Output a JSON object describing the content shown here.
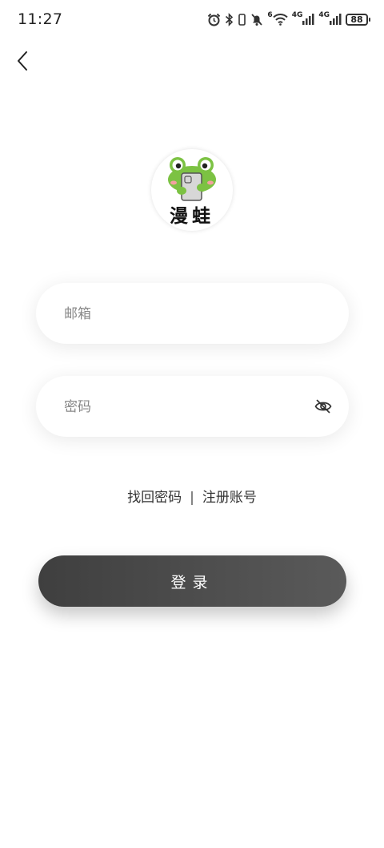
{
  "status_bar": {
    "time": "11:27",
    "network_1": "4G",
    "network_2": "4G",
    "wifi_badge": "6",
    "battery": "88"
  },
  "icons": {
    "back": "back-arrow-icon",
    "alarm": "alarm-icon",
    "bluetooth": "bluetooth-icon",
    "vibrate": "vibrate-icon",
    "mute": "bell-mute-icon",
    "wifi": "wifi-icon",
    "signal": "signal-icon",
    "eye": "eye-off-icon"
  },
  "logo": {
    "text": "漫蛙"
  },
  "form": {
    "email_placeholder": "邮箱",
    "email_value": "",
    "password_placeholder": "密码",
    "password_value": ""
  },
  "links": {
    "forgot_password": "找回密码",
    "separator": "|",
    "register": "注册账号"
  },
  "login_button": {
    "label": "登录"
  },
  "colors": {
    "button_start": "#3f3f3f",
    "button_end": "#5a5a5a",
    "frog_green": "#7cc243",
    "background": "#ffffff"
  }
}
